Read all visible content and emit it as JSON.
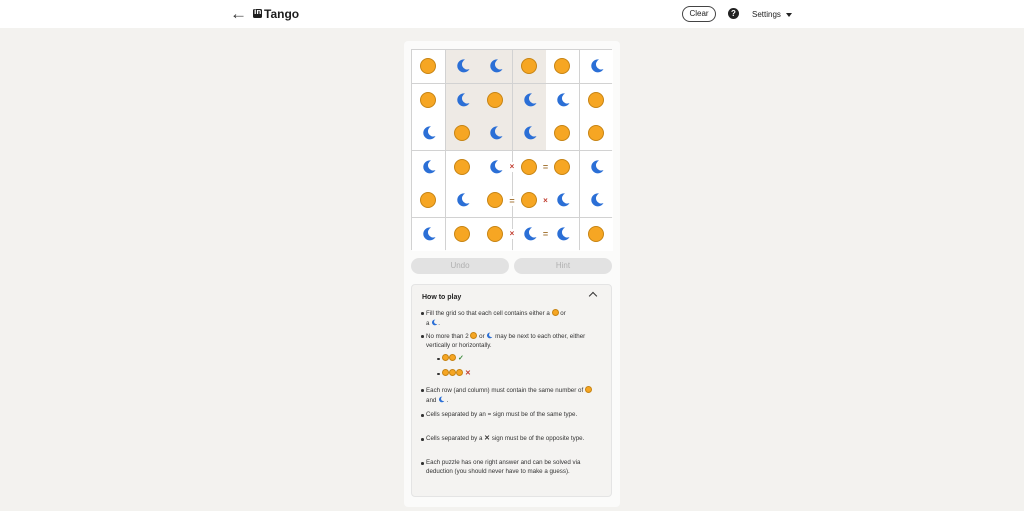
{
  "header": {
    "back_icon": "arrow-left-icon",
    "app_title": "Tango",
    "clear_label": "Clear",
    "help_icon": "question-circle-icon",
    "help_label": "?",
    "settings_label": "Settings",
    "back_glyph": "←"
  },
  "colors": {
    "sun": "#f6a623",
    "moon": "#2b6fd6",
    "locked_cell": "#eeeae5",
    "eq_sign": "#a77a3c",
    "x_sign": "#c0392b"
  },
  "board": {
    "cells": [
      [
        "sun",
        "moon",
        "moon",
        "sun",
        "sun",
        "moon"
      ],
      [
        "sun",
        "moon",
        "sun",
        "moon",
        "moon",
        "sun"
      ],
      [
        "moon",
        "sun",
        "moon",
        "moon",
        "sun",
        "sun"
      ],
      [
        "moon",
        "sun",
        "moon",
        "sun",
        "sun",
        "moon"
      ],
      [
        "sun",
        "moon",
        "sun",
        "sun",
        "moon",
        "moon"
      ],
      [
        "moon",
        "sun",
        "sun",
        "moon",
        "moon",
        "sun"
      ]
    ],
    "locked": [
      [
        false,
        true,
        true,
        true,
        false,
        false
      ],
      [
        false,
        true,
        true,
        true,
        false,
        false
      ],
      [
        false,
        true,
        true,
        true,
        false,
        false
      ],
      [
        false,
        false,
        false,
        false,
        false,
        false
      ],
      [
        false,
        false,
        false,
        false,
        false,
        false
      ],
      [
        false,
        false,
        false,
        false,
        false,
        false
      ]
    ],
    "constraints": [
      {
        "row": 3,
        "col": 2,
        "dir": "right",
        "sign": "×"
      },
      {
        "row": 3,
        "col": 3,
        "dir": "right",
        "sign": "="
      },
      {
        "row": 4,
        "col": 2,
        "dir": "right",
        "sign": "="
      },
      {
        "row": 4,
        "col": 3,
        "dir": "right",
        "sign": "×"
      },
      {
        "row": 5,
        "col": 2,
        "dir": "right",
        "sign": "×"
      },
      {
        "row": 5,
        "col": 3,
        "dir": "right",
        "sign": "="
      }
    ]
  },
  "actions": {
    "undo_label": "Undo",
    "hint_label": "Hint"
  },
  "how_to_play": {
    "title": "How to play",
    "rule1_a": "Fill the grid so that each cell contains either a",
    "rule1_b": "or",
    "rule1_c": "a",
    "rule1_d": ".",
    "rule2_a": "No more than 2",
    "rule2_b": "or",
    "rule2_c": "may be next to each other, either vertically or horizontally.",
    "example_ok": "✓",
    "example_bad": "✕",
    "rule3_a": "Each row (and column) must contain the same number of",
    "rule3_b": "and",
    "rule3_c": ".",
    "rule4": "Cells separated by an = sign must be of the same type.",
    "rule5_a": "Cells separated by a",
    "rule5_x": "✕",
    "rule5_b": "sign must be of the opposite type.",
    "rule6": "Each puzzle has one right answer and can be solved via deduction (you should never have to make a guess)."
  }
}
